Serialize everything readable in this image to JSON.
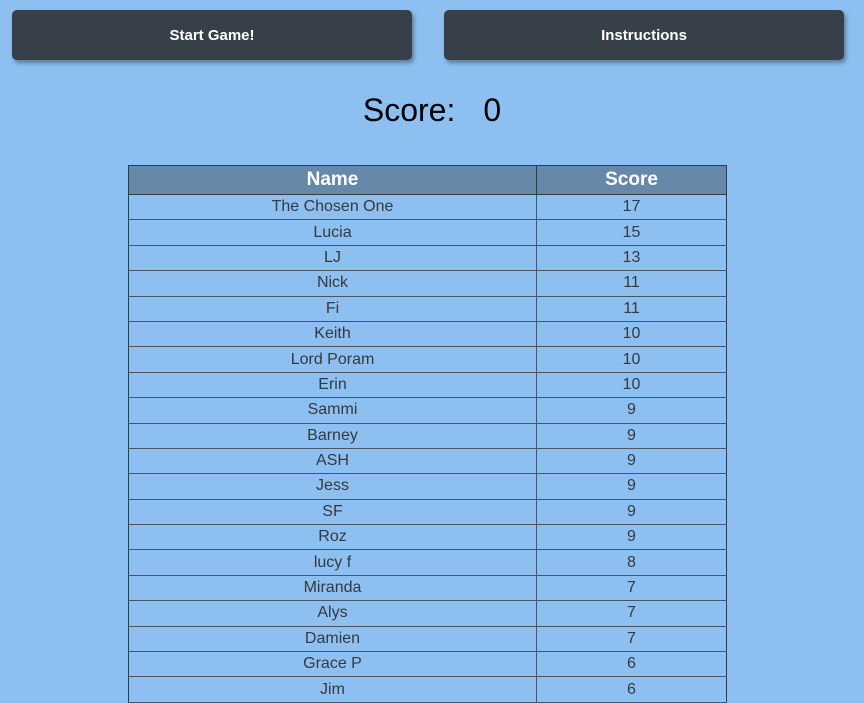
{
  "controls": {
    "start_label": "Start Game!",
    "instructions_label": "Instructions"
  },
  "score": {
    "label": "Score:",
    "value": "0"
  },
  "leaderboard": {
    "headers": [
      "Name",
      "Score"
    ],
    "rows": [
      [
        "The Chosen One",
        "17"
      ],
      [
        "Lucia",
        "15"
      ],
      [
        "LJ",
        "13"
      ],
      [
        "Nick",
        "11"
      ],
      [
        "Fi",
        "11"
      ],
      [
        "Keith",
        "10"
      ],
      [
        "Lord Poram",
        "10"
      ],
      [
        "Erin",
        "10"
      ],
      [
        "Sammi",
        "9"
      ],
      [
        "Barney",
        "9"
      ],
      [
        "ASH",
        "9"
      ],
      [
        "Jess",
        "9"
      ],
      [
        "SF",
        "9"
      ],
      [
        "Roz",
        "9"
      ],
      [
        "lucy f",
        "8"
      ],
      [
        "Miranda",
        "7"
      ],
      [
        "Alys",
        "7"
      ],
      [
        "Damien",
        "7"
      ],
      [
        "Grace P",
        "6"
      ],
      [
        "Jim",
        "6"
      ]
    ]
  },
  "colors": {
    "background": "#8dbff0",
    "button": "#374049",
    "header": "#6689aa"
  }
}
